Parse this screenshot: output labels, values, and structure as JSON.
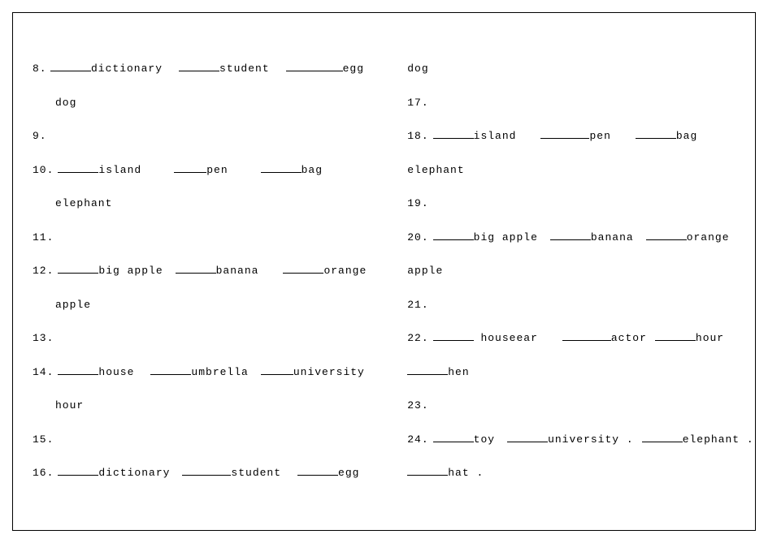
{
  "left_column": [
    {
      "num": "8. ",
      "cont": false,
      "parts": [
        {
          "blank": "b-m"
        },
        {
          "text": "dictionary"
        },
        {
          "gap": 20
        },
        {
          "blank": "b-m"
        },
        {
          "text": "student"
        },
        {
          "gap": 20
        },
        {
          "blank": "b-xl"
        },
        {
          "text": "egg"
        }
      ]
    },
    {
      "num": "",
      "cont": true,
      "parts": [
        {
          "text": "dog"
        }
      ]
    },
    {
      "num": "9. ",
      "cont": false,
      "parts": []
    },
    {
      "num": "10.",
      "cont": false,
      "parts": [
        {
          "gap": 5
        },
        {
          "blank": "b-m"
        },
        {
          "text": "island"
        },
        {
          "gap": 40
        },
        {
          "blank": "b-s"
        },
        {
          "text": "pen"
        },
        {
          "gap": 40
        },
        {
          "blank": "b-m"
        },
        {
          "text": "bag"
        }
      ]
    },
    {
      "num": "",
      "cont": true,
      "parts": [
        {
          "text": "elephant"
        }
      ]
    },
    {
      "num": "11.",
      "cont": false,
      "parts": []
    },
    {
      "num": "12.",
      "cont": false,
      "parts": [
        {
          "gap": 5
        },
        {
          "blank": "b-m"
        },
        {
          "text": "big apple"
        },
        {
          "gap": 15
        },
        {
          "blank": "b-m"
        },
        {
          "text": "banana"
        },
        {
          "gap": 30
        },
        {
          "blank": "b-m"
        },
        {
          "text": "orange"
        }
      ]
    },
    {
      "num": "",
      "cont": true,
      "parts": [
        {
          "text": "apple"
        }
      ]
    },
    {
      "num": "13.",
      "cont": false,
      "parts": []
    },
    {
      "num": "14.",
      "cont": false,
      "parts": [
        {
          "gap": 5
        },
        {
          "blank": "b-m"
        },
        {
          "text": "house"
        },
        {
          "gap": 20
        },
        {
          "blank": "b-m"
        },
        {
          "text": "umbrella"
        },
        {
          "gap": 15
        },
        {
          "blank": "b-s"
        },
        {
          "text": "university"
        }
      ]
    },
    {
      "num": "",
      "cont": true,
      "parts": [
        {
          "text": "hour"
        }
      ]
    },
    {
      "num": "15.",
      "cont": false,
      "parts": []
    },
    {
      "num": "16.",
      "cont": false,
      "parts": [
        {
          "gap": 5
        },
        {
          "blank": "b-m"
        },
        {
          "text": "dictionary"
        },
        {
          "gap": 15
        },
        {
          "blank": "b-l"
        },
        {
          "text": "student"
        },
        {
          "gap": 20
        },
        {
          "blank": "b-m"
        },
        {
          "text": "egg"
        }
      ]
    }
  ],
  "right_column": [
    {
      "num": "",
      "cont": false,
      "parts": [
        {
          "text": "dog"
        }
      ]
    },
    {
      "num": "17.",
      "cont": false,
      "parts": []
    },
    {
      "num": "18.",
      "cont": false,
      "parts": [
        {
          "gap": 5
        },
        {
          "blank": "b-m"
        },
        {
          "text": "island"
        },
        {
          "gap": 30
        },
        {
          "blank": "b-l"
        },
        {
          "text": "pen"
        },
        {
          "gap": 30
        },
        {
          "blank": "b-m"
        },
        {
          "text": "bag"
        }
      ]
    },
    {
      "num": "",
      "cont": false,
      "parts": [
        {
          "text": "elephant"
        }
      ]
    },
    {
      "num": "19.",
      "cont": false,
      "parts": []
    },
    {
      "num": "20.",
      "cont": false,
      "parts": [
        {
          "gap": 5
        },
        {
          "blank": "b-m"
        },
        {
          "text": "big apple"
        },
        {
          "gap": 15
        },
        {
          "blank": "b-m"
        },
        {
          "text": "banana"
        },
        {
          "gap": 15
        },
        {
          "blank": "b-m"
        },
        {
          "text": "orange"
        }
      ]
    },
    {
      "num": "",
      "cont": false,
      "parts": [
        {
          "text": "apple"
        }
      ]
    },
    {
      "num": "21.",
      "cont": false,
      "parts": []
    },
    {
      "num": "22.",
      "cont": false,
      "parts": [
        {
          "gap": 5
        },
        {
          "blank": "b-m"
        },
        {
          "text": " houseear"
        },
        {
          "gap": 30
        },
        {
          "blank": "b-l"
        },
        {
          "text": "actor"
        },
        {
          "gap": 10
        },
        {
          "blank": "b-m"
        },
        {
          "text": "hour"
        }
      ]
    },
    {
      "num": "",
      "cont": false,
      "parts": [
        {
          "blank": "b-m"
        },
        {
          "text": "hen"
        }
      ]
    },
    {
      "num": "23.",
      "cont": false,
      "parts": []
    },
    {
      "num": "24.",
      "cont": false,
      "parts": [
        {
          "gap": 5
        },
        {
          "blank": "b-m"
        },
        {
          "text": "toy"
        },
        {
          "gap": 15
        },
        {
          "blank": "b-m"
        },
        {
          "text": "university ."
        },
        {
          "gap": 10
        },
        {
          "blank": "b-m"
        },
        {
          "text": "elephant ."
        }
      ]
    },
    {
      "num": "",
      "cont": false,
      "parts": [
        {
          "blank": "b-m"
        },
        {
          "text": "hat ."
        }
      ]
    }
  ]
}
